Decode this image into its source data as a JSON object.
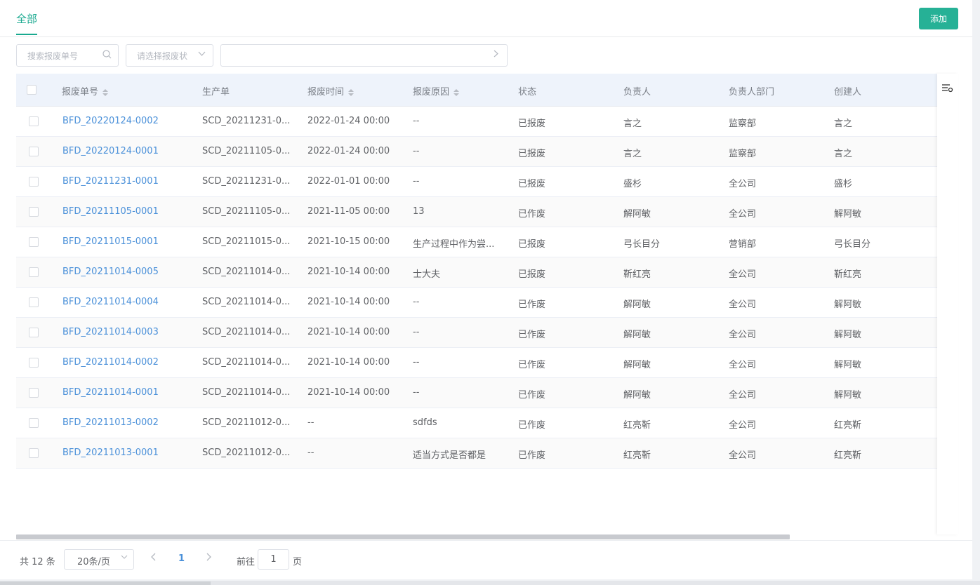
{
  "tabs": {
    "active": "全部"
  },
  "header": {
    "add_label": "添加"
  },
  "filters": {
    "search_placeholder": "搜索报废单号",
    "status_placeholder": "请选择报废状",
    "range_placeholder": ""
  },
  "table": {
    "columns": [
      "报废单号",
      "生产单",
      "报废时间",
      "报废原因",
      "状态",
      "负责人",
      "负责人部门",
      "创建人"
    ],
    "rows": [
      {
        "no": "BFD_20220124-0002",
        "order": "SCD_20211231-0...",
        "time": "2022-01-24 00:00",
        "reason": "--",
        "status": "已报废",
        "owner": "言之",
        "dept": "监察部",
        "creator": "言之"
      },
      {
        "no": "BFD_20220124-0001",
        "order": "SCD_20211105-0...",
        "time": "2022-01-24 00:00",
        "reason": "--",
        "status": "已报废",
        "owner": "言之",
        "dept": "监察部",
        "creator": "言之"
      },
      {
        "no": "BFD_20211231-0001",
        "order": "SCD_20211231-0...",
        "time": "2022-01-01 00:00",
        "reason": "--",
        "status": "已报废",
        "owner": "盛杉",
        "dept": "全公司",
        "creator": "盛杉"
      },
      {
        "no": "BFD_20211105-0001",
        "order": "SCD_20211105-0...",
        "time": "2021-11-05 00:00",
        "reason": "13",
        "status": "已作废",
        "owner": "解阿敏",
        "dept": "全公司",
        "creator": "解阿敏"
      },
      {
        "no": "BFD_20211015-0001",
        "order": "SCD_20211015-0...",
        "time": "2021-10-15 00:00",
        "reason": "生产过程中作为尝...",
        "status": "已报废",
        "owner": "弓长目分",
        "dept": "营销部",
        "creator": "弓长目分"
      },
      {
        "no": "BFD_20211014-0005",
        "order": "SCD_20211014-0...",
        "time": "2021-10-14 00:00",
        "reason": "士大夫",
        "status": "已报废",
        "owner": "靳红亮",
        "dept": "全公司",
        "creator": "靳红亮"
      },
      {
        "no": "BFD_20211014-0004",
        "order": "SCD_20211014-0...",
        "time": "2021-10-14 00:00",
        "reason": "--",
        "status": "已作废",
        "owner": "解阿敏",
        "dept": "全公司",
        "creator": "解阿敏"
      },
      {
        "no": "BFD_20211014-0003",
        "order": "SCD_20211014-0...",
        "time": "2021-10-14 00:00",
        "reason": "--",
        "status": "已作废",
        "owner": "解阿敏",
        "dept": "全公司",
        "creator": "解阿敏"
      },
      {
        "no": "BFD_20211014-0002",
        "order": "SCD_20211014-0...",
        "time": "2021-10-14 00:00",
        "reason": "--",
        "status": "已作废",
        "owner": "解阿敏",
        "dept": "全公司",
        "creator": "解阿敏"
      },
      {
        "no": "BFD_20211014-0001",
        "order": "SCD_20211014-0...",
        "time": "2021-10-14 00:00",
        "reason": "--",
        "status": "已作废",
        "owner": "解阿敏",
        "dept": "全公司",
        "creator": "解阿敏"
      },
      {
        "no": "BFD_20211013-0002",
        "order": "SCD_20211012-0...",
        "time": "--",
        "reason": "sdfds",
        "status": "已作废",
        "owner": "红亮靳",
        "dept": "全公司",
        "creator": "红亮靳"
      },
      {
        "no": "BFD_20211013-0001",
        "order": "SCD_20211012-0...",
        "time": "--",
        "reason": "适当方式是否都是",
        "status": "已作废",
        "owner": "红亮靳",
        "dept": "全公司",
        "creator": "红亮靳"
      }
    ]
  },
  "pagination": {
    "total_text": "共 12 条",
    "page_size": "20条/页",
    "current_page": "1",
    "goto_prefix": "前往",
    "goto_value": "1",
    "goto_suffix": "页"
  },
  "colors": {
    "accent": "#26b196",
    "link": "#4a90d9"
  }
}
